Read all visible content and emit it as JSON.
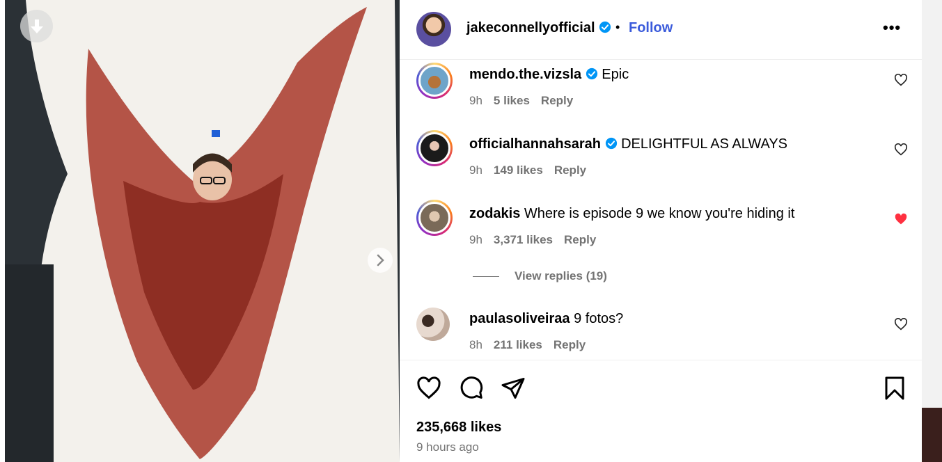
{
  "post": {
    "author": "jakeconnellyofficial",
    "follow_label": "Follow",
    "separator": "•",
    "more_label": "•••",
    "likes": "235,668 likes",
    "time": "9 hours ago"
  },
  "comments": [
    {
      "user": "mendo.the.vizsla",
      "text": "Epic",
      "verified": true,
      "time": "9h",
      "likes": "5 likes",
      "reply": "Reply",
      "liked": false
    },
    {
      "user": "officialhannahsarah",
      "text": "DELIGHTFUL AS ALWAYS",
      "verified": true,
      "time": "9h",
      "likes": "149 likes",
      "reply": "Reply",
      "liked": false
    },
    {
      "user": "zodakis",
      "text": "Where is episode 9 we know you're hiding it",
      "verified": false,
      "time": "9h",
      "likes": "3,371 likes",
      "reply": "Reply",
      "liked": true
    },
    {
      "user": "paulasoliveiraa",
      "text": "9 fotos?",
      "verified": false,
      "time": "8h",
      "likes": "211 likes",
      "reply": "Reply",
      "liked": false
    }
  ],
  "view_replies": "View replies (19)",
  "colors": {
    "accent": "#3b5bdb",
    "verified": "#0095f6",
    "liked": "#ff3040",
    "muted": "#737373"
  },
  "icons": {
    "download": "download-icon",
    "next": "chevron-right-icon",
    "like": "heart-icon",
    "comment": "comment-icon",
    "share": "send-icon",
    "save": "bookmark-icon",
    "more": "more-icon"
  }
}
